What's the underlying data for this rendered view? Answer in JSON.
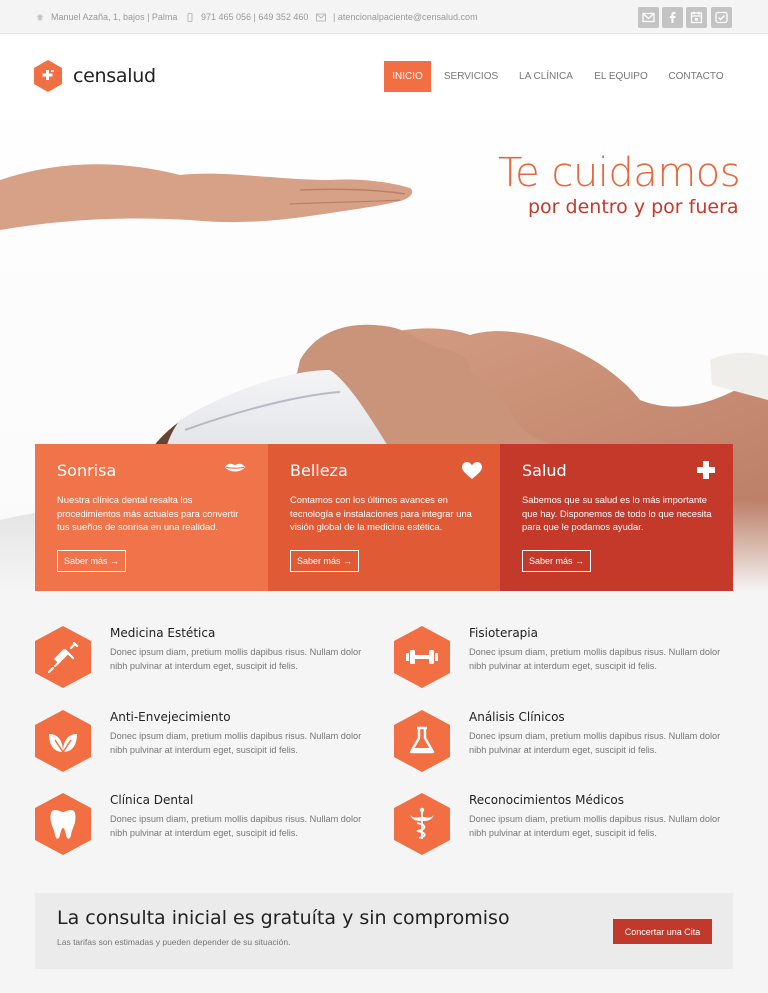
{
  "topbar": {
    "address": "Manuel Azaña, 1, bajos | Palma",
    "phone": "971 465 056 | 649 352 460",
    "email": "| atencionalpaciente@censalud.com",
    "social_icons": [
      "email-icon",
      "facebook-icon",
      "calendar-icon",
      "chat-icon"
    ]
  },
  "brand": {
    "name": "censalud"
  },
  "nav": {
    "items": [
      "INICIO",
      "SERVICIOS",
      "LA CLÍNICA",
      "EL EQUIPO",
      "CONTACTO"
    ]
  },
  "hero": {
    "line1": "Te cuidamos",
    "line2": "por dentro y por fuera"
  },
  "boxes": [
    {
      "title": "Sonrisa",
      "text": "Nuestra clínica dental resalta los procedimientos más actuales para convertir tus sueños de sonrisa en una realidad.",
      "button": "Saber más →",
      "icon": "lips-icon",
      "color": "#f0734a"
    },
    {
      "title": "Belleza",
      "text": "Contamos con los últimos avances en tecnología e instalaciones para integrar una visión global de la medicina estética.",
      "button": "Saber más →",
      "icon": "heart-icon",
      "color": "#e05a36"
    },
    {
      "title": "Salud",
      "text": "Sabemos que su salud es lo más importante que hay. Disponemos de todo lo que necesita para que le podamos ayudar.",
      "button": "Saber más →",
      "icon": "plus-icon",
      "color": "#c4392a"
    }
  ],
  "features": [
    {
      "title": "Medicina Estética",
      "text": "Donec ipsum diam, pretium mollis dapibus risus. Nullam dolor nibh pulvinar at interdum eget, suscipit id felis.",
      "icon": "syringe-icon"
    },
    {
      "title": "Fisioterapia",
      "text": "Donec ipsum diam, pretium mollis dapibus risus. Nullam dolor nibh pulvinar at interdum eget, suscipit id felis.",
      "icon": "dumbbell-icon"
    },
    {
      "title": "Anti-Envejecimiento",
      "text": "Donec ipsum diam, pretium mollis dapibus risus. Nullam dolor nibh pulvinar at interdum eget, suscipit id felis.",
      "icon": "leaves-icon"
    },
    {
      "title": "Análisis Clínicos",
      "text": "Donec ipsum diam, pretium mollis dapibus risus. Nullam dolor nibh pulvinar at interdum eget, suscipit id felis.",
      "icon": "flask-icon"
    },
    {
      "title": "Clínica Dental",
      "text": "Donec ipsum diam, pretium mollis dapibus risus. Nullam dolor nibh pulvinar at interdum eget, suscipit id felis.",
      "icon": "tooth-icon"
    },
    {
      "title": "Reconocimientos Médicos",
      "text": "Donec ipsum diam, pretium mollis dapibus risus. Nullam dolor nibh pulvinar at interdum eget, suscipit id felis.",
      "icon": "caduceus-icon"
    }
  ],
  "cta": {
    "title": "La consulta inicial es gratuíta y sin compromiso",
    "subtitle": "Las tarifas son estimadas y pueden depender de su situación.",
    "button": "Concertar una Cita"
  },
  "colors": {
    "accent": "#f16f42",
    "dark_red": "#c0392b",
    "orange": "#e05a36"
  }
}
